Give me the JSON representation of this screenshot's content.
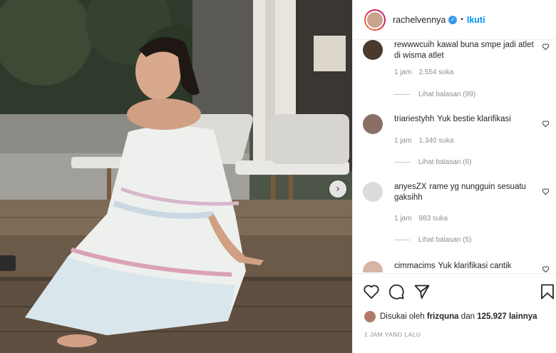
{
  "header": {
    "username": "rachelvennya",
    "verified_glyph": "✓",
    "separator": "•",
    "follow_label": "Ikuti"
  },
  "photo": {
    "next_glyph": "›"
  },
  "comments": [
    {
      "username": "rewwwcuih",
      "text": "kawal buna smpe jadi atlet di wisma atlet",
      "time": "1 jam",
      "likes": "2.554 suka",
      "replies": "Lihat balasan (99)",
      "avatar_color": "#4a3a2e"
    },
    {
      "username": "triariestyhh",
      "text": "Yuk bestie klarifikasi",
      "time": "1 jam",
      "likes": "1.340 suka",
      "replies": "Lihat balasan (6)",
      "avatar_color": "#8a7064"
    },
    {
      "username": "anyesZX",
      "text": "rame yg nungguin sesuatu gaksihh",
      "time": "1 jam",
      "likes": "983 suka",
      "replies": "Lihat balasan (5)",
      "avatar_color": "#dcdcdc"
    },
    {
      "username": "cimmacims",
      "text": "Yuk klarifikasi cantik",
      "avatar_color": "#d8b4a6"
    }
  ],
  "actions": {
    "liked_by_prefix": "Disukai oleh",
    "liked_by_user": "frizquna",
    "liked_by_and": "dan",
    "liked_by_count": "125.927 lainnya",
    "timestamp": "1 JAM YANG LALU"
  },
  "colors": {
    "accent": "#0095f6",
    "verified": "#3897f0",
    "muted": "#8e8e8e"
  },
  "icons": [
    "heart-icon",
    "comment-icon",
    "share-icon",
    "bookmark-icon",
    "chevron-right-icon",
    "verified-icon"
  ]
}
